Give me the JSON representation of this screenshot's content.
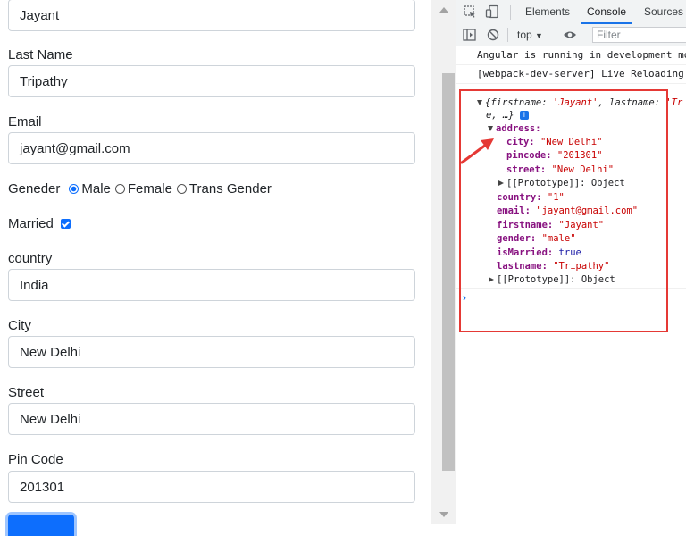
{
  "form": {
    "firstname_value": "Jayant",
    "lastname_label": "Last Name",
    "lastname_value": "Tripathy",
    "email_label": "Email",
    "email_value": "jayant@gmail.com",
    "gender_label": "Geneder",
    "gender_options": [
      "Male",
      "Female",
      "Trans Gender"
    ],
    "married_label": "Married",
    "country_label": "country",
    "country_value": "India",
    "city_label": "City",
    "city_value": "New Delhi",
    "street_label": "Street",
    "street_value": "New Delhi",
    "pincode_label": "Pin Code",
    "pincode_value": "201301"
  },
  "devtools": {
    "tabs": [
      "Elements",
      "Console",
      "Sources"
    ],
    "active_tab": "Console",
    "context": "top",
    "filter_placeholder": "Filter",
    "messages": [
      "Angular is running in development mod",
      "[webpack-dev-server] Live Reloading e"
    ],
    "object": {
      "summary_open": "{",
      "summary_k1": "firstname:",
      "summary_v1": "'Jayant'",
      "summary_k2": "lastname:",
      "summary_v2": "'Tr",
      "summary_cont": "e, …}",
      "info": "i",
      "address_key": "address:",
      "city_key": "city:",
      "city_val": "\"New Delhi\"",
      "pincode_key": "pincode:",
      "pincode_val": "\"201301\"",
      "street_key": "street:",
      "street_val": "\"New Delhi\"",
      "proto_label": "[[Prototype]]: Object",
      "country_key": "country:",
      "country_val": "\"1\"",
      "email_key": "email:",
      "email_val": "\"jayant@gmail.com\"",
      "firstname_key": "firstname:",
      "firstname_val": "\"Jayant\"",
      "gender_key": "gender:",
      "gender_val": "\"male\"",
      "married_key": "isMarried:",
      "married_val": "true",
      "lastname_key": "lastname:",
      "lastname_val": "\"Tripathy\""
    },
    "prompt": "›"
  },
  "colors": {
    "accent": "#0d6efd",
    "highlight": "#e53935",
    "devtools_blue": "#1a73e8"
  }
}
